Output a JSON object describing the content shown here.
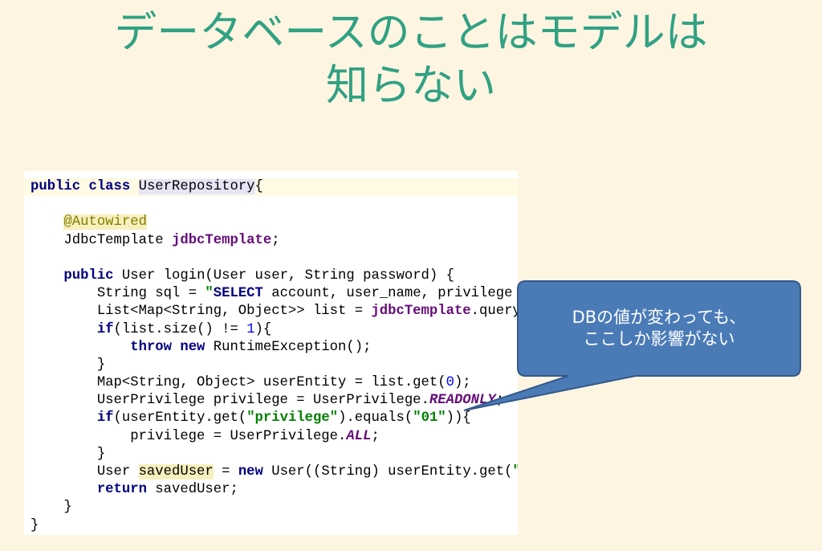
{
  "slide": {
    "title_lines": [
      "データベースのことはモデルは",
      "知らない"
    ],
    "colors": {
      "background": "#fdf5e2",
      "title": "#31a183"
    }
  },
  "code": {
    "background": "#ffffff",
    "caret_line_color": "#fffae3",
    "lines": [
      {
        "caret_line": true,
        "tokens": [
          {
            "text": "public class",
            "color": "#000080",
            "bold": true
          },
          {
            "text": " "
          },
          {
            "text": "UserRepository",
            "bg": "#e6e5f7"
          },
          {
            "text": "{"
          }
        ]
      },
      {
        "tokens": []
      },
      {
        "tokens": [
          {
            "text": "    "
          },
          {
            "text": "@Autowired",
            "color": "#808000",
            "bg": "#f7efbd"
          }
        ]
      },
      {
        "tokens": [
          {
            "text": "    JdbcTemplate "
          },
          {
            "text": "jdbcTemplate",
            "color": "#660e7a",
            "bold": true
          },
          {
            "text": ";"
          }
        ]
      },
      {
        "tokens": []
      },
      {
        "tokens": [
          {
            "text": "    "
          },
          {
            "text": "public",
            "color": "#000080",
            "bold": true
          },
          {
            "text": " User login(User user, String password) {"
          }
        ]
      },
      {
        "tokens": [
          {
            "text": "        String sql = "
          },
          {
            "text": "\"",
            "color": "#008000",
            "bold": true
          },
          {
            "text": "SELECT",
            "color": "#000080",
            "bold": true
          },
          {
            "text": " account, user_name, privilege"
          }
        ]
      },
      {
        "tokens": [
          {
            "text": "        List<Map<String, Object>> list = "
          },
          {
            "text": "jdbcTemplate",
            "color": "#660e7a",
            "bold": true
          },
          {
            "text": ".query"
          }
        ]
      },
      {
        "tokens": [
          {
            "text": "        "
          },
          {
            "text": "if",
            "color": "#000080",
            "bold": true
          },
          {
            "text": "(list.size() != "
          },
          {
            "text": "1",
            "color": "#0000ff"
          },
          {
            "text": "){"
          }
        ]
      },
      {
        "tokens": [
          {
            "text": "            "
          },
          {
            "text": "throw new",
            "color": "#000080",
            "bold": true
          },
          {
            "text": " RuntimeException();"
          }
        ]
      },
      {
        "tokens": [
          {
            "text": "        }"
          }
        ]
      },
      {
        "tokens": [
          {
            "text": "        Map<String, Object> userEntity = list.get("
          },
          {
            "text": "0",
            "color": "#0000ff"
          },
          {
            "text": ");"
          }
        ]
      },
      {
        "tokens": [
          {
            "text": "        UserPrivilege privilege = UserPrivilege."
          },
          {
            "text": "READONLY",
            "color": "#660e7a",
            "bold": true,
            "italic": true
          },
          {
            "text": ";"
          }
        ]
      },
      {
        "tokens": [
          {
            "text": "        "
          },
          {
            "text": "if",
            "color": "#000080",
            "bold": true
          },
          {
            "text": "(userEntity.get("
          },
          {
            "text": "\"privilege\"",
            "color": "#008000",
            "bold": true
          },
          {
            "text": ").equals("
          },
          {
            "text": "\"01\"",
            "color": "#008000",
            "bold": true
          },
          {
            "text": ")){"
          }
        ]
      },
      {
        "tokens": [
          {
            "text": "            privilege = UserPrivilege."
          },
          {
            "text": "ALL",
            "color": "#660e7a",
            "bold": true,
            "italic": true
          },
          {
            "text": ";"
          }
        ]
      },
      {
        "tokens": [
          {
            "text": "        }"
          }
        ]
      },
      {
        "tokens": [
          {
            "text": "        User "
          },
          {
            "text": "savedUser",
            "bg": "#f7efbd"
          },
          {
            "text": " = "
          },
          {
            "text": "new",
            "color": "#000080",
            "bold": true
          },
          {
            "text": " User((String) userEntity.get("
          },
          {
            "text": "\"",
            "color": "#008000",
            "bold": true
          }
        ]
      },
      {
        "tokens": [
          {
            "text": "        "
          },
          {
            "text": "return",
            "color": "#000080",
            "bold": true
          },
          {
            "text": " savedUser;"
          }
        ]
      },
      {
        "tokens": [
          {
            "text": "    }"
          }
        ]
      },
      {
        "tokens": [
          {
            "text": "}"
          }
        ]
      }
    ]
  },
  "callout": {
    "lines": [
      "DBの値が変わっても、",
      "ここしか影響がない"
    ],
    "colors": {
      "fill": "#4a7bb7",
      "border": "#34598a",
      "text": "#ffffff"
    }
  }
}
